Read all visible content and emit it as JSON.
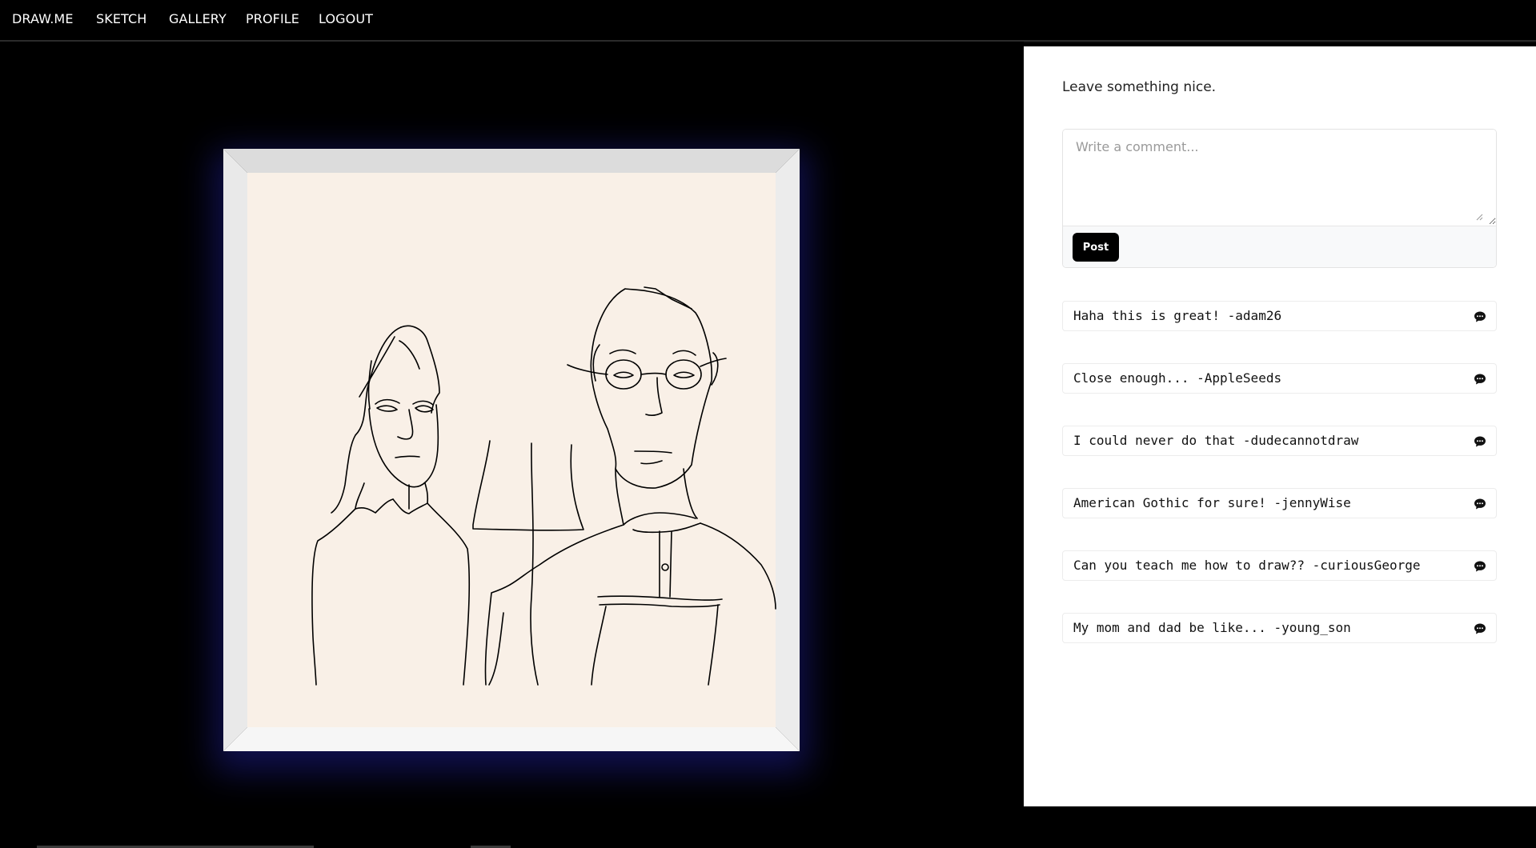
{
  "nav": {
    "brand": "DRAW.ME",
    "items": [
      {
        "label": "SKETCH"
      },
      {
        "label": "GALLERY"
      },
      {
        "label": "PROFILE"
      },
      {
        "label": "LOGOUT"
      }
    ]
  },
  "artwork": {
    "canvas_color": "#f9f0e7",
    "frame_color": "#eeeeee"
  },
  "sidebar": {
    "prompt": "Leave something nice.",
    "comment_placeholder": "Write a comment...",
    "post_label": "Post",
    "comments": [
      {
        "text": "Haha this is great! -adam26"
      },
      {
        "text": "Close enough... -AppleSeeds"
      },
      {
        "text": "I could never do that -dudecannotdraw"
      },
      {
        "text": "American Gothic for sure! -jennyWise"
      },
      {
        "text": "Can you teach me how to draw?? -curiousGeorge"
      },
      {
        "text": "My mom and dad be like... -young_son"
      }
    ]
  },
  "icons": {
    "reply": "speech-bubble-icon"
  }
}
